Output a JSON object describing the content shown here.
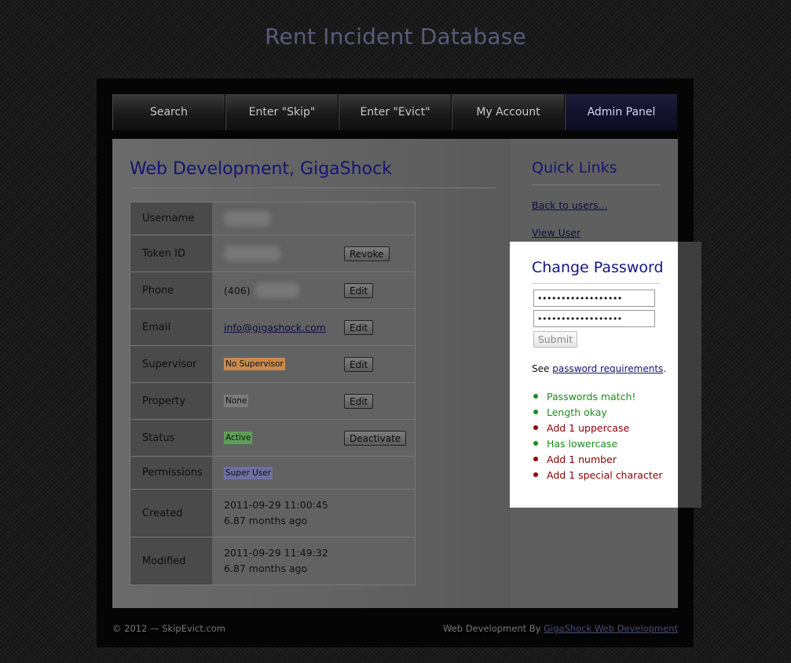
{
  "site": {
    "title": "Rent Incident Database"
  },
  "nav": {
    "items": [
      {
        "label": "Search"
      },
      {
        "label": "Enter \"Skip\""
      },
      {
        "label": "Enter \"Evict\""
      },
      {
        "label": "My Account"
      },
      {
        "label": "Admin Panel",
        "active": true
      }
    ]
  },
  "main": {
    "title": "Web Development, GigaShock",
    "rows": {
      "username": {
        "label": "Username"
      },
      "token": {
        "label": "Token ID",
        "button": "Revoke"
      },
      "phone": {
        "label": "Phone",
        "value_prefix": "(406)",
        "button": "Edit"
      },
      "email": {
        "label": "Email",
        "value": "info@gigashock.com",
        "button": "Edit"
      },
      "supervisor": {
        "label": "Supervisor",
        "value": "No Supervisor",
        "button": "Edit",
        "color": "#c98a4f"
      },
      "property": {
        "label": "Property",
        "value": "None",
        "button": "Edit",
        "color": "#7a7a7a"
      },
      "status": {
        "label": "Status",
        "value": "Active",
        "button": "Deactivate",
        "color": "#5f9e58"
      },
      "permissions": {
        "label": "Permissions",
        "value": "Super User",
        "color": "#6f6fa4"
      },
      "created": {
        "label": "Created",
        "date": "2011-09-29 11:00:45",
        "ago": "6.87 months ago"
      },
      "modified": {
        "label": "Modified",
        "date": "2011-09-29 11:49:32",
        "ago": "6.87 months ago"
      }
    }
  },
  "quick_links": {
    "title": "Quick Links",
    "links": [
      {
        "label": "Back to users..."
      },
      {
        "label": "View User"
      }
    ]
  },
  "change_password": {
    "title": "Change Password",
    "password_value": "••••••••••••••••••",
    "confirm_value": "••••••••••••••••••",
    "submit_label": "Submit",
    "see_prefix": "See",
    "see_link": "password requirements",
    "see_suffix": ".",
    "requirements": [
      {
        "text": "Passwords match!",
        "ok": true
      },
      {
        "text": "Length okay",
        "ok": true
      },
      {
        "text": "Add 1 uppercase",
        "ok": false
      },
      {
        "text": "Has lowercase",
        "ok": true
      },
      {
        "text": "Add 1 number",
        "ok": false
      },
      {
        "text": "Add 1 special character",
        "ok": false
      }
    ]
  },
  "footer": {
    "copyright": "© 2012 — SkipEvict.com",
    "credit_prefix": "Web Development By",
    "credit_link": "GigaShock Web Development"
  }
}
